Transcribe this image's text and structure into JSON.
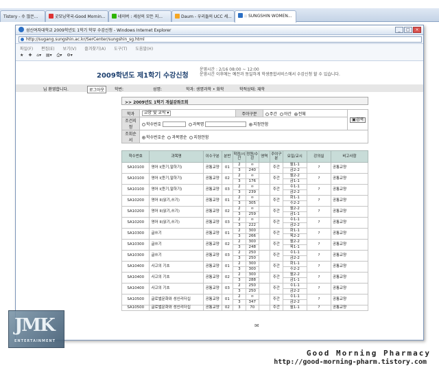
{
  "tabs": [
    {
      "label": "Tistory - 수 많은..."
    },
    {
      "label": "굿모닝약국-Good Mornin..."
    },
    {
      "label": "네이버 : 세상의 모든 지..."
    },
    {
      "label": "Daum - 우리들의 UCC 세..."
    },
    {
      "label": ":: SUNGSHIN WOMEN..."
    }
  ],
  "window": {
    "title": "성신여자대학교 2009학년도 1학기 학부 수강신청 - Windows Internet Explorer",
    "url": "http://sugang.sungshin.ac.kr/SerCenter/sungshin_sg.html",
    "menu": [
      "파일(F)",
      "편집(E)",
      "보기(V)",
      "즐겨찾기(A)",
      "도구(T)",
      "도움말(H)"
    ]
  },
  "page": {
    "title": "2009학년도 제1학기 수강신청",
    "notice1": "운영시간 : 2/16 08:00 ~ 12:00",
    "notice2": "운영시간 이후에는 예전과 동일하게 학생종합서비스에서 수강신청 할 수 있습니다.",
    "greeting": "님 환영합니다.",
    "logout": "로그아웃",
    "student_no_label": "학번:",
    "name_label": "성명:",
    "dept_label": "학과: 생명과학 • 화학",
    "status_label": "학적상태: 재학"
  },
  "panel": {
    "title": ">> 2009년도 1학기 개설강좌조회",
    "row1_label": "학과",
    "row1_select": "교양 및 교직",
    "day_label": "주야구분",
    "day_opts": [
      "주간",
      "야간",
      "전체"
    ],
    "row2_label": "조건지정",
    "cond_opts": [
      "학수번호",
      "과목명",
      "지정안함"
    ],
    "row3_label": "조회순서",
    "order_opts": [
      "학수번호순",
      "과목명순",
      "지정안함"
    ],
    "search_button": "검색"
  },
  "table": {
    "headers": [
      "학수번호",
      "과목명",
      "이수구분",
      "분반",
      "학점/시간",
      "정원/수강",
      "영역",
      "주야구분",
      "요일/교시",
      "강의실",
      "비고사항"
    ],
    "rows": [
      [
        "SA10100",
        "영어 I(듣기,말하기)",
        "공통교양",
        "01",
        "2",
        "∞",
        "주간",
        "월1-1",
        "?",
        "공통교양"
      ],
      [
        "",
        "",
        "",
        "",
        "3",
        "240",
        "",
        "금2-2",
        "",
        ""
      ],
      [
        "SA10100",
        "영어 I(듣기,말하기)",
        "공통교양",
        "02",
        "2",
        "∞",
        "주간",
        "월2-2",
        "?",
        "공통교양"
      ],
      [
        "",
        "",
        "",
        "",
        "3",
        "176",
        "",
        "금1-1",
        "",
        ""
      ],
      [
        "SA10100",
        "영어 I(듣기,말하기)",
        "공통교양",
        "03",
        "2",
        "∞",
        "주간",
        "수1-1",
        "?",
        "공통교양"
      ],
      [
        "",
        "",
        "",
        "",
        "3",
        "239",
        "",
        "금2-2",
        "",
        ""
      ],
      [
        "SA10200",
        "영어 II(읽기,쓰기)",
        "공통교양",
        "01",
        "2",
        "∞",
        "주간",
        "화1-1",
        "?",
        "공통교양"
      ],
      [
        "",
        "",
        "",
        "",
        "3",
        "305",
        "",
        "수2-2",
        "",
        ""
      ],
      [
        "SA10200",
        "영어 II(읽기,쓰기)",
        "공통교양",
        "02",
        "2",
        "∞",
        "주간",
        "월2-2",
        "?",
        "공통교양"
      ],
      [
        "",
        "",
        "",
        "",
        "3",
        "259",
        "",
        "금1-1",
        "",
        ""
      ],
      [
        "SA10200",
        "영어 II(읽기,쓰기)",
        "공통교양",
        "03",
        "2",
        "∞",
        "주간",
        "수1-1",
        "?",
        "공통교양"
      ],
      [
        "",
        "",
        "",
        "",
        "3",
        "222",
        "",
        "금2-2",
        "",
        ""
      ],
      [
        "SA10300",
        "글쓰기",
        "공통교양",
        "01",
        "2",
        "300",
        "주간",
        "화1-1",
        "?",
        "공통교양"
      ],
      [
        "",
        "",
        "",
        "",
        "3",
        "266",
        "",
        "목2-2",
        "",
        ""
      ],
      [
        "SA10300",
        "글쓰기",
        "공통교양",
        "02",
        "2",
        "300",
        "주간",
        "월2-2",
        "?",
        "공통교양"
      ],
      [
        "",
        "",
        "",
        "",
        "3",
        "248",
        "",
        "목1-1",
        "",
        ""
      ],
      [
        "SA10300",
        "글쓰기",
        "공통교양",
        "03",
        "2",
        "250",
        "주간",
        "수1-1",
        "?",
        "공통교양"
      ],
      [
        "",
        "",
        "",
        "",
        "3",
        "250",
        "",
        "금2-2",
        "",
        ""
      ],
      [
        "SA10400",
        "사고의 기초",
        "공통교양",
        "01",
        "2",
        "300",
        "주간",
        "화1-1",
        "?",
        "공통교양"
      ],
      [
        "",
        "",
        "",
        "",
        "3",
        "300",
        "",
        "수2-2",
        "",
        ""
      ],
      [
        "SA10400",
        "사고의 기초",
        "공통교양",
        "02",
        "2",
        "300",
        "주간",
        "월2-2",
        "?",
        "공통교양"
      ],
      [
        "",
        "",
        "",
        "",
        "3",
        "288",
        "",
        "금1-1",
        "",
        ""
      ],
      [
        "SA10400",
        "사고의 기초",
        "공통교양",
        "03",
        "2",
        "250",
        "주간",
        "수1-1",
        "?",
        "공통교양"
      ],
      [
        "",
        "",
        "",
        "",
        "3",
        "250",
        "",
        "금2-2",
        "",
        ""
      ],
      [
        "SA10500",
        "글로벌문화와 성신리더십",
        "공통교양",
        "01",
        "2",
        "∞",
        "주간",
        "수1-1",
        "?",
        "공통교양"
      ],
      [
        "",
        "",
        "",
        "",
        "3",
        "347",
        "",
        "금2-2",
        "",
        ""
      ],
      [
        "SA10500",
        "글로벌문화와 성신리더십",
        "공통교양",
        "02",
        "3",
        "70",
        "주간",
        "월1-1",
        "?",
        "공통교양"
      ]
    ]
  },
  "signature": {
    "line1": "Good Morning Pharmacy",
    "line2": "http://good-morning-pharm.tistory.com"
  },
  "logo": {
    "text": "JMK",
    "sub": "ENTERTAINMENT"
  }
}
